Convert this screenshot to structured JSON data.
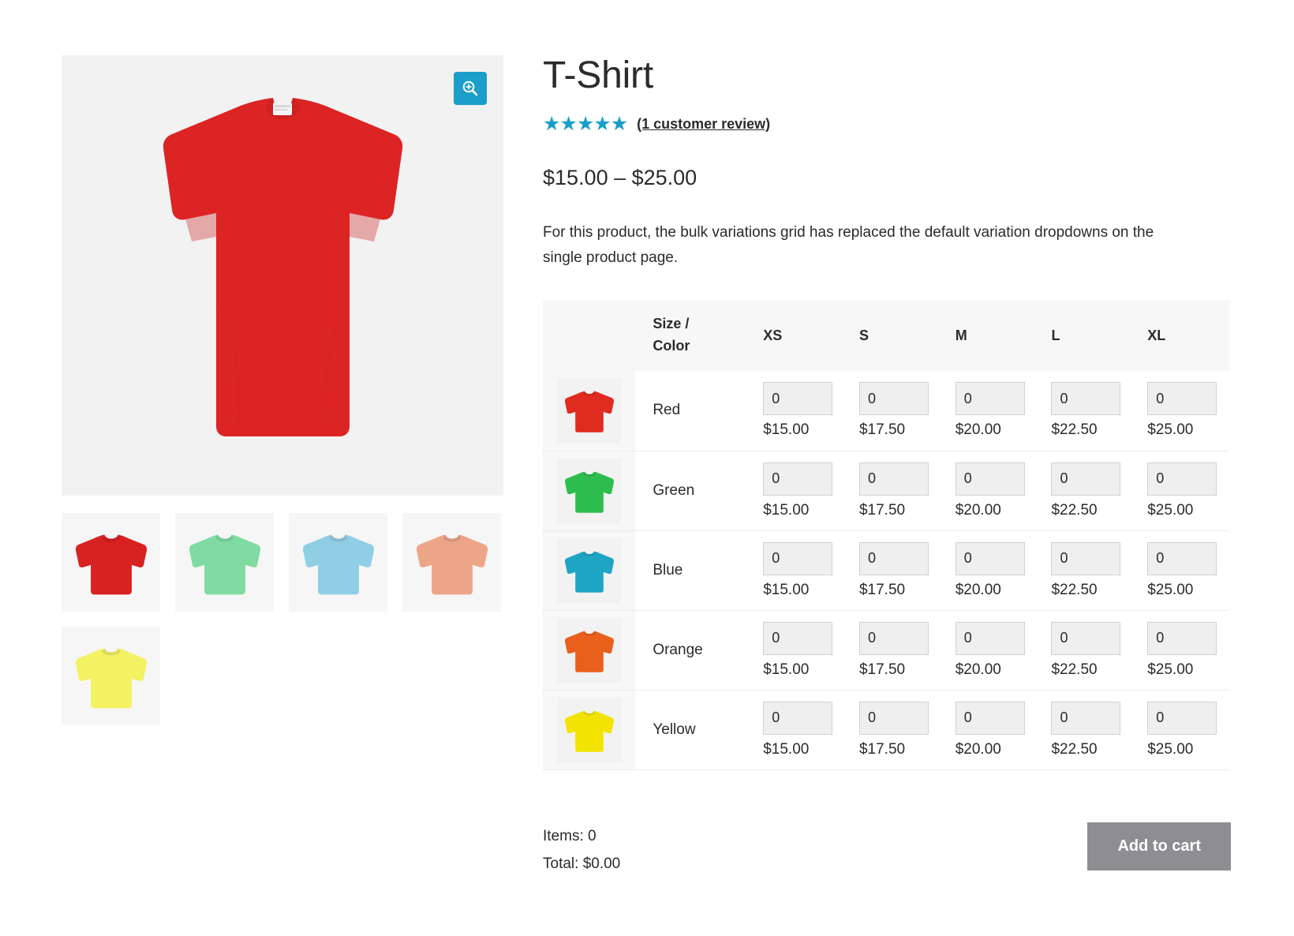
{
  "product": {
    "title": "T-Shirt",
    "rating_stars": 5,
    "rating_glyph": "★",
    "review_link": "(1 customer review)",
    "price_range": "$15.00 – $25.00",
    "description": "For this product, the bulk variations grid has replaced the default variation dropdowns on the single product page."
  },
  "gallery": {
    "zoom_icon": "magnifier-plus-icon",
    "main_image_alt": "red-tshirt",
    "main_image_bg": "#f2f2f2",
    "main_shirt_color": "#dc2424",
    "thumbnails": [
      {
        "name": "red-tshirt-thumb",
        "color": "#d82222"
      },
      {
        "name": "green-tshirt-thumb",
        "color": "#80dba2"
      },
      {
        "name": "blue-tshirt-thumb",
        "color": "#90cee5"
      },
      {
        "name": "orange-tshirt-thumb",
        "color": "#eda588"
      },
      {
        "name": "yellow-tshirt-thumb",
        "color": "#f2f263"
      }
    ]
  },
  "variations_grid": {
    "header": {
      "corner_label_line1": "Size /",
      "corner_label_line2": "Color",
      "sizes": [
        "XS",
        "S",
        "M",
        "L",
        "XL"
      ]
    },
    "rows": [
      {
        "color_label": "Red",
        "swatch": "#e02b20",
        "thumb_name": "red-tshirt-row-thumb",
        "qty": [
          "0",
          "0",
          "0",
          "0",
          "0"
        ],
        "prices": [
          "$15.00",
          "$17.50",
          "$20.00",
          "$22.50",
          "$25.00"
        ]
      },
      {
        "color_label": "Green",
        "swatch": "#2dbd4e",
        "thumb_name": "green-tshirt-row-thumb",
        "qty": [
          "0",
          "0",
          "0",
          "0",
          "0"
        ],
        "prices": [
          "$15.00",
          "$17.50",
          "$20.00",
          "$22.50",
          "$25.00"
        ]
      },
      {
        "color_label": "Blue",
        "swatch": "#1fa5c4",
        "thumb_name": "blue-tshirt-row-thumb",
        "qty": [
          "0",
          "0",
          "0",
          "0",
          "0"
        ],
        "prices": [
          "$15.00",
          "$17.50",
          "$20.00",
          "$22.50",
          "$25.00"
        ]
      },
      {
        "color_label": "Orange",
        "swatch": "#e8601c",
        "thumb_name": "orange-tshirt-row-thumb",
        "qty": [
          "0",
          "0",
          "0",
          "0",
          "0"
        ],
        "prices": [
          "$15.00",
          "$17.50",
          "$20.00",
          "$22.50",
          "$25.00"
        ]
      },
      {
        "color_label": "Yellow",
        "swatch": "#f2e400",
        "thumb_name": "yellow-tshirt-row-thumb",
        "qty": [
          "0",
          "0",
          "0",
          "0",
          "0"
        ],
        "prices": [
          "$15.00",
          "$17.50",
          "$20.00",
          "$22.50",
          "$25.00"
        ]
      }
    ]
  },
  "footer": {
    "items_text": "Items: 0",
    "total_text": "Total: $0.00",
    "add_to_cart_label": "Add to cart"
  },
  "colors": {
    "accent": "#1a9ec9",
    "button_gray": "#8d8d92",
    "header_bg": "#f7f7f7",
    "input_bg": "#efefef",
    "text": "#2b2b2b"
  }
}
